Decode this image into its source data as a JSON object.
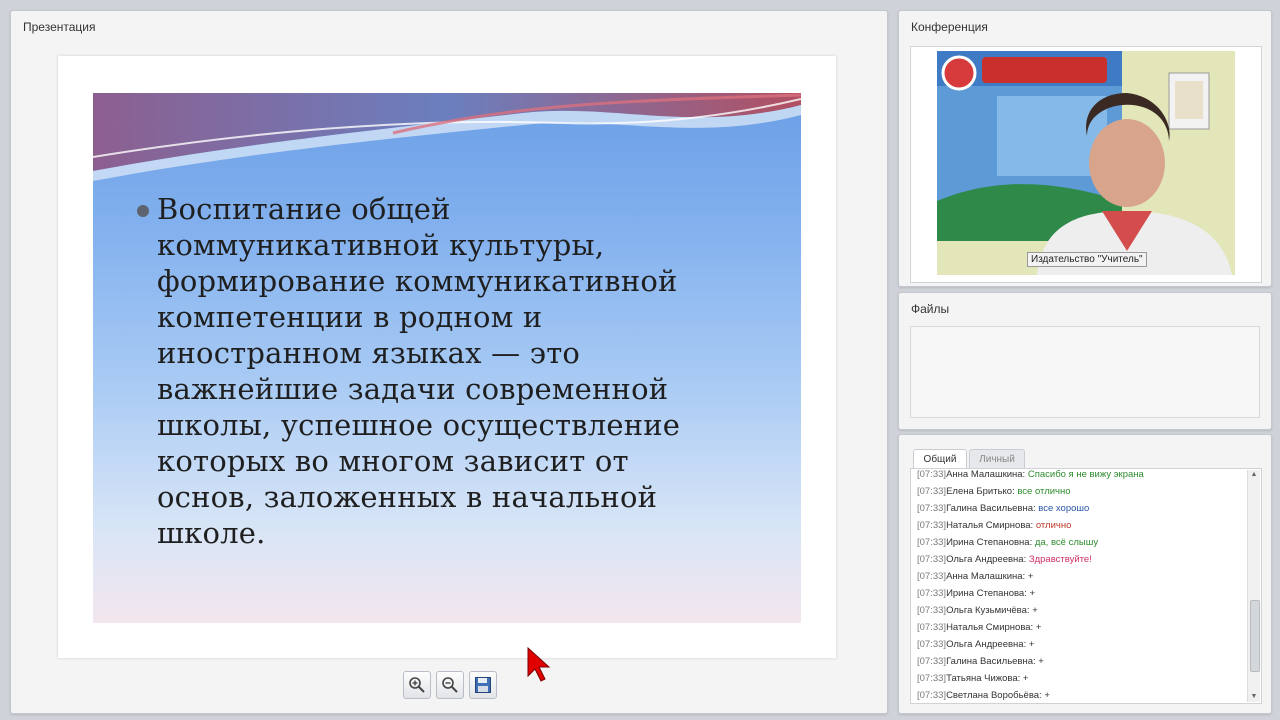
{
  "presentation": {
    "title": "Презентация",
    "slide_lines": [
      "Воспитание общей",
      "коммуникативной культуры,",
      "формирование коммуникативной",
      "компетенции в родном и",
      "иностранном языках — это",
      "важнейшие задачи современной",
      "школы, успешное осуществление",
      "которых во многом зависит от",
      "основ, заложенных в начальной",
      "школе."
    ],
    "toolbar": {
      "zoom_in_icon": "zoom-in-icon",
      "zoom_out_icon": "zoom-out-icon",
      "save_icon": "floppy-disk-icon"
    }
  },
  "conference": {
    "title": "Конференция",
    "video_caption": "Издательство \"Учитель\""
  },
  "files": {
    "title": "Файлы"
  },
  "chat": {
    "tabs": [
      "Общий",
      "Личный"
    ],
    "messages": [
      {
        "time": "[07:33]",
        "name": "Анна Малашкина:",
        "text": "Спасибо я не вижу экрана",
        "color": "green"
      },
      {
        "time": "[07:33]",
        "name": "Елена Бритько:",
        "text": "все отлично",
        "color": "green"
      },
      {
        "time": "[07:33]",
        "name": "Галина Васильевна:",
        "text": "все хорошо",
        "color": "blue"
      },
      {
        "time": "[07:33]",
        "name": "Наталья Смирнова:",
        "text": "отлично",
        "color": "red"
      },
      {
        "time": "[07:33]",
        "name": "Ирина Степановна:",
        "text": "да, всё слышу",
        "color": "green"
      },
      {
        "time": "[07:33]",
        "name": "Ольга Андреевна:",
        "text": "Здравствуйте!",
        "color": "pink"
      },
      {
        "time": "[07:33]",
        "name": "Анна Малашкина:",
        "text": "+",
        "color": "dark"
      },
      {
        "time": "[07:33]",
        "name": "Ирина Степанова:",
        "text": "+",
        "color": "dark"
      },
      {
        "time": "[07:33]",
        "name": "Ольга Кузьмичёва:",
        "text": "+",
        "color": "dark"
      },
      {
        "time": "[07:33]",
        "name": "Наталья Смирнова:",
        "text": "+",
        "color": "dark"
      },
      {
        "time": "[07:33]",
        "name": "Ольга Андреевна:",
        "text": "+",
        "color": "dark"
      },
      {
        "time": "[07:33]",
        "name": "Галина Васильевна:",
        "text": "+",
        "color": "dark"
      },
      {
        "time": "[07:33]",
        "name": "Татьяна Чижова:",
        "text": "+",
        "color": "dark"
      },
      {
        "time": "[07:33]",
        "name": "Светлана Воробьёва:",
        "text": "+",
        "color": "dark"
      }
    ]
  },
  "colors": {
    "slide_blue": "#86b3ef",
    "wave_red": "#c0505a",
    "accent_green": "#2e8b2e"
  }
}
